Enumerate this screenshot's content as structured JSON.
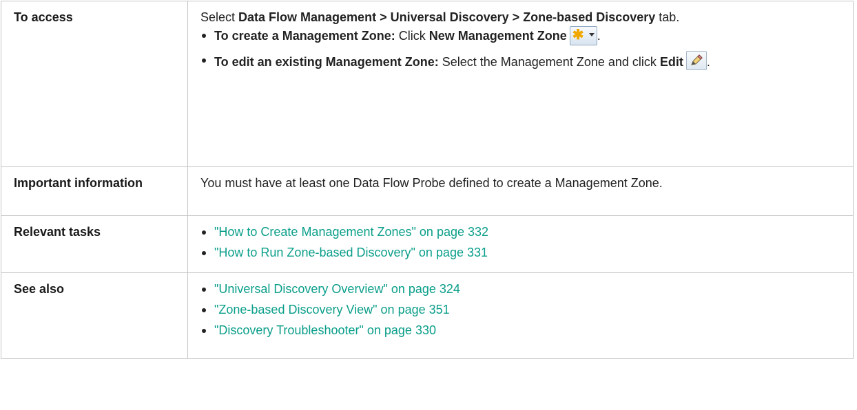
{
  "rows": {
    "access": {
      "label": "To access",
      "intro": {
        "select": "Select ",
        "path": "Data Flow Management > Universal Discovery > Zone-based Discovery",
        "tab": " tab."
      },
      "items": [
        {
          "bold_lead": "To create a Management Zone:",
          "text": " Click ",
          "action": "New Management Zone",
          "icon": "new-zone-icon",
          "tail": "."
        },
        {
          "bold_lead": "To edit an existing Management Zone:",
          "text": " Select the Management Zone and click ",
          "action": "Edit",
          "icon": "edit-pencil-icon",
          "tail": "."
        }
      ]
    },
    "important": {
      "label": "Important information",
      "text": "You must have at least one Data Flow Probe defined to create a Management Zone."
    },
    "tasks": {
      "label": "Relevant tasks",
      "links": [
        "\"How to Create Management Zones\" on page 332",
        "\"How to Run Zone-based Discovery\" on page 331"
      ]
    },
    "see_also": {
      "label": "See also",
      "links": [
        "\"Universal Discovery Overview\" on page 324",
        "\"Zone-based Discovery View\" on page 351",
        "\"Discovery Troubleshooter\" on page 330"
      ]
    }
  },
  "colors": {
    "link": "#0a9e8a",
    "border": "#c4c4c4",
    "text": "#222222"
  }
}
